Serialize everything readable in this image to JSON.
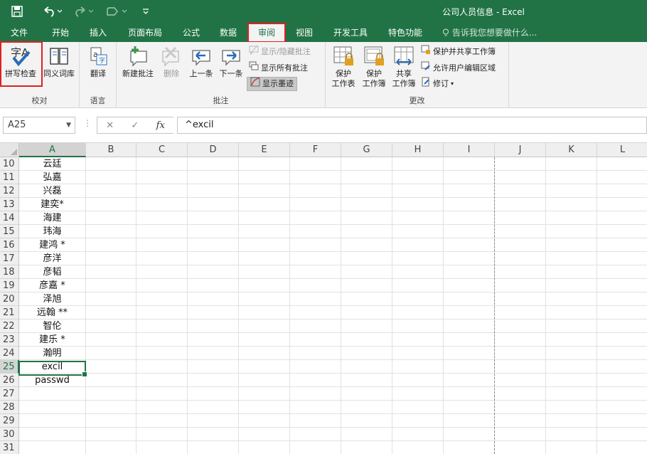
{
  "titlebar": {
    "title": "公司人员信息 - Excel",
    "save_icon": "floppy-disk-icon",
    "undo_icon": "undo-arrow-icon",
    "redo_icon": "redo-arrow-icon",
    "touch_icon": "touch-mode-icon",
    "customize_icon": "customize-toolbar-icon"
  },
  "tabs": [
    {
      "label": "文件",
      "active": false
    },
    {
      "label": "开始",
      "active": false
    },
    {
      "label": "插入",
      "active": false
    },
    {
      "label": "页面布局",
      "active": false
    },
    {
      "label": "公式",
      "active": false
    },
    {
      "label": "数据",
      "active": false
    },
    {
      "label": "审阅",
      "active": true
    },
    {
      "label": "视图",
      "active": false
    },
    {
      "label": "开发工具",
      "active": false
    },
    {
      "label": "特色功能",
      "active": false
    }
  ],
  "tell_me": "告诉我您想要做什么...",
  "ribbon": {
    "proofing": {
      "label": "校对",
      "spell_check": "拼写检查",
      "spell_glyph": "字A",
      "thesaurus": "同义词库"
    },
    "language": {
      "label": "语言",
      "translate": "翻译"
    },
    "comments": {
      "label": "批注",
      "new_comment": "新建批注",
      "delete": "删除",
      "previous": "上一条",
      "next": "下一条",
      "show_hide": "显示/隐藏批注",
      "show_all": "显示所有批注",
      "show_ink": "显示墨迹"
    },
    "changes": {
      "label": "更改",
      "protect_sheet_1": "保护",
      "protect_sheet_2": "工作表",
      "protect_wb_1": "保护",
      "protect_wb_2": "工作簿",
      "share_wb_1": "共享",
      "share_wb_2": "工作簿",
      "protect_share": "保护并共享工作簿",
      "allow_edit": "允许用户编辑区域",
      "track": "修订"
    }
  },
  "formula_bar": {
    "name_box": "A25",
    "cancel": "✕",
    "enter": "✓",
    "fx": "fx",
    "content": "^excil"
  },
  "grid": {
    "columns": [
      "A",
      "B",
      "C",
      "D",
      "E",
      "F",
      "G",
      "H",
      "I",
      "J",
      "K",
      "L"
    ],
    "selected_column": "A",
    "rows": [
      {
        "num": "10",
        "a": "云廷"
      },
      {
        "num": "11",
        "a": "弘嘉"
      },
      {
        "num": "12",
        "a": "兴磊"
      },
      {
        "num": "13",
        "a": "建奕*"
      },
      {
        "num": "14",
        "a": "海建"
      },
      {
        "num": "15",
        "a": "玮海"
      },
      {
        "num": "16",
        "a": "建鸿 *"
      },
      {
        "num": "17",
        "a": "彦洋"
      },
      {
        "num": "18",
        "a": "彦韬"
      },
      {
        "num": "19",
        "a": "彦嘉 *"
      },
      {
        "num": "20",
        "a": "泽旭"
      },
      {
        "num": "21",
        "a": "远翰 **"
      },
      {
        "num": "22",
        "a": "智伦"
      },
      {
        "num": "23",
        "a": "建乐 *"
      },
      {
        "num": "24",
        "a": "瀚明"
      },
      {
        "num": "25",
        "a": "excil"
      },
      {
        "num": "26",
        "a": "passwd"
      },
      {
        "num": "27",
        "a": ""
      },
      {
        "num": "28",
        "a": ""
      },
      {
        "num": "29",
        "a": ""
      },
      {
        "num": "30",
        "a": ""
      },
      {
        "num": "31",
        "a": ""
      }
    ],
    "active_row": "25"
  },
  "colors": {
    "accent": "#217346",
    "highlight_box": "#e02020"
  }
}
